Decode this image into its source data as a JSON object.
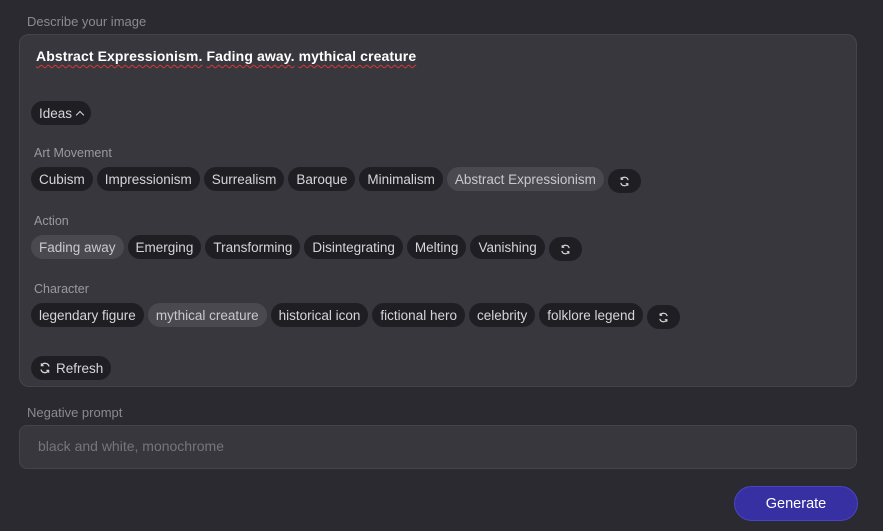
{
  "describe": {
    "label": "Describe your image",
    "prompt_words": [
      "Abstract Expressionism.",
      "Fading away.",
      "mythical creature"
    ]
  },
  "ideas": {
    "label": "Ideas"
  },
  "sections": [
    {
      "label": "Art Movement",
      "chips": [
        {
          "label": "Cubism",
          "selected": false
        },
        {
          "label": "Impressionism",
          "selected": false
        },
        {
          "label": "Surrealism",
          "selected": false
        },
        {
          "label": "Baroque",
          "selected": false
        },
        {
          "label": "Minimalism",
          "selected": false
        },
        {
          "label": "Abstract Expressionism",
          "selected": true
        }
      ]
    },
    {
      "label": "Action",
      "chips": [
        {
          "label": "Fading away",
          "selected": true
        },
        {
          "label": "Emerging",
          "selected": false
        },
        {
          "label": "Transforming",
          "selected": false
        },
        {
          "label": "Disintegrating",
          "selected": false
        },
        {
          "label": "Melting",
          "selected": false
        },
        {
          "label": "Vanishing",
          "selected": false
        }
      ]
    },
    {
      "label": "Character",
      "chips": [
        {
          "label": "legendary figure",
          "selected": false
        },
        {
          "label": "mythical creature",
          "selected": true
        },
        {
          "label": "historical icon",
          "selected": false
        },
        {
          "label": "fictional hero",
          "selected": false
        },
        {
          "label": "celebrity",
          "selected": false
        },
        {
          "label": "folklore legend",
          "selected": false
        }
      ]
    }
  ],
  "refresh": {
    "label": "Refresh",
    "icon": "refresh-icon"
  },
  "negative": {
    "label": "Negative prompt",
    "placeholder": "black and white, monochrome",
    "value": ""
  },
  "generate": {
    "label": "Generate"
  },
  "colors": {
    "background": "#2b2a30",
    "panel": "#38373e",
    "chip": "#1f1e23",
    "chip_selected": "#4a4950",
    "accent": "#3730a3"
  }
}
